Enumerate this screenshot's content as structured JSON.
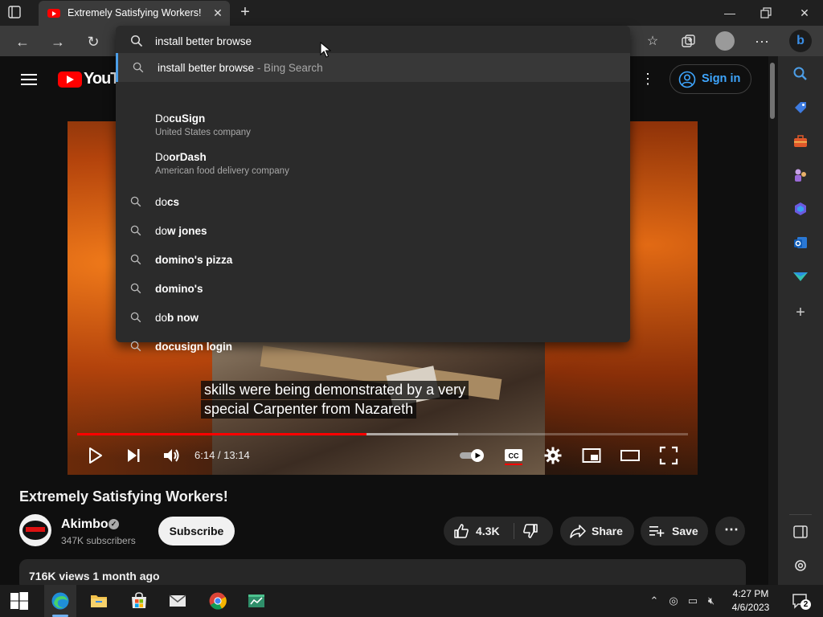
{
  "browser": {
    "tab_title": "Extremely Satisfying Workers! - YouTube",
    "omnibox_text": "install better browse",
    "suggestions": [
      {
        "typed": "install better browse",
        "completion": "",
        "extra": " - Bing Search",
        "icon": "search-icon"
      },
      {
        "typed": "Do",
        "completion": "cuSign",
        "subtitle": "United States company",
        "icon": ""
      },
      {
        "typed": "Do",
        "completion": "orDash",
        "subtitle": "American food delivery company",
        "icon": ""
      },
      {
        "typed": "do",
        "completion": "cs",
        "icon": "search-icon"
      },
      {
        "typed": "do",
        "completion": "w jones",
        "icon": "search-icon"
      },
      {
        "typed": "",
        "completion": "domino's pizza",
        "icon": "search-icon"
      },
      {
        "typed": "",
        "completion": "domino's",
        "icon": "search-icon"
      },
      {
        "typed": "do",
        "completion": "b now",
        "icon": "search-icon"
      },
      {
        "typed": "",
        "completion": "docusign login",
        "icon": "search-icon"
      }
    ]
  },
  "youtube": {
    "logo_text": "YouTu",
    "sign_in": "Sign in",
    "caption_line1": "skills were being demonstrated by a very",
    "caption_line2": "special Carpenter from Nazareth",
    "time": "6:14 / 13:14",
    "played_fraction": 0.474,
    "buffered_fraction": 0.624,
    "video_title": "Extremely Satisfying Workers!",
    "channel": "Akimbo",
    "subscribers": "347K subscribers",
    "subscribe": "Subscribe",
    "likes": "4.3K",
    "share": "Share",
    "save": "Save",
    "views_date": "716K views  1 month ago"
  },
  "taskbar": {
    "time": "4:27 PM",
    "date": "4/6/2023",
    "notifications": "2"
  },
  "colors": {
    "accent": "#3ea6ff",
    "yt_red": "#ff0000",
    "edge_highlight": "#4c9ee8"
  }
}
